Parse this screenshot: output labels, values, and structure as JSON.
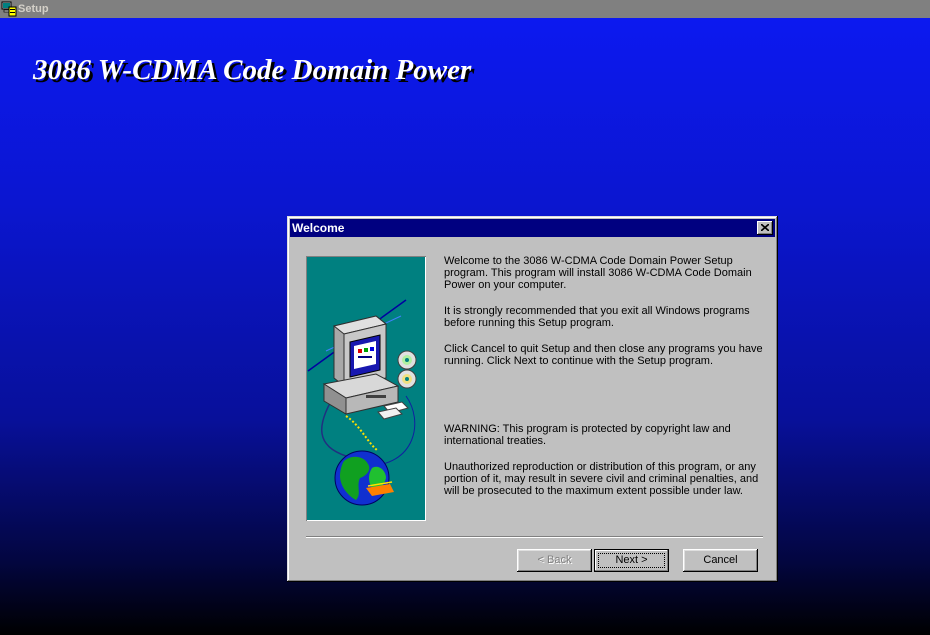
{
  "window": {
    "title": "Setup",
    "icon": "setup-icon"
  },
  "banner": {
    "title": "3086 W-CDMA Code Domain Power"
  },
  "dialog": {
    "title": "Welcome",
    "close_icon": "close-icon",
    "illustration": "computer-cd-globe-illustration",
    "paragraphs": [
      "Welcome to the 3086 W-CDMA Code Domain Power Setup program.  This program will install 3086 W-CDMA Code Domain Power on your computer.",
      "It is strongly recommended that you exit all Windows programs before running this Setup program.",
      "Click Cancel to quit Setup and then close any programs you have running.  Click Next to continue with the Setup program.",
      "WARNING: This program is protected by copyright law and international treaties.",
      "Unauthorized reproduction or distribution of this program, or any portion of it, may result in severe civil and criminal penalties, and will be prosecuted to the maximum extent possible under law."
    ],
    "buttons": {
      "back": "< Back",
      "next": "Next >",
      "cancel": "Cancel"
    }
  },
  "colors": {
    "dialog_title": "#000080",
    "desktop_top": "#0c19f0",
    "illustration_bg": "#008080",
    "face": "#c0c0c0"
  }
}
